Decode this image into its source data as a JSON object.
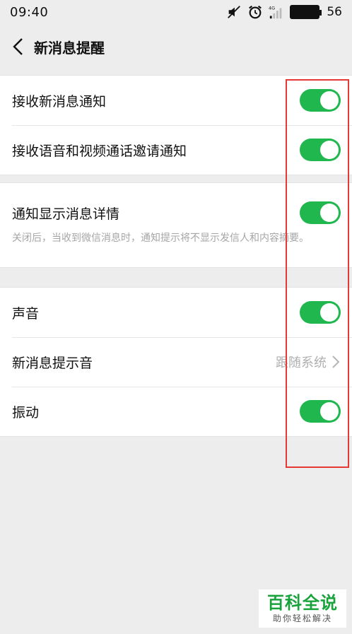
{
  "status_bar": {
    "time": "09:40",
    "network_label": "4G",
    "battery": "56"
  },
  "header": {
    "title": "新消息提醒"
  },
  "group1": {
    "rows": [
      {
        "label": "接收新消息通知",
        "toggle": true
      },
      {
        "label": "接收语音和视频通话邀请通知",
        "toggle": true
      }
    ]
  },
  "group2": {
    "label": "通知显示消息详情",
    "toggle": true,
    "description": "关闭后，当收到微信消息时，通知提示将不显示发信人和内容摘要。"
  },
  "group3": {
    "sound": {
      "label": "声音",
      "toggle": true
    },
    "tone": {
      "label": "新消息提示音",
      "value": "跟随系统"
    },
    "vibrate": {
      "label": "振动",
      "toggle": true
    }
  },
  "colors": {
    "toggle_on": "#1fb74e",
    "highlight": "#e53935",
    "background": "#ededed"
  },
  "watermark": {
    "main": "百科全说",
    "sub": "助你轻松解决"
  }
}
